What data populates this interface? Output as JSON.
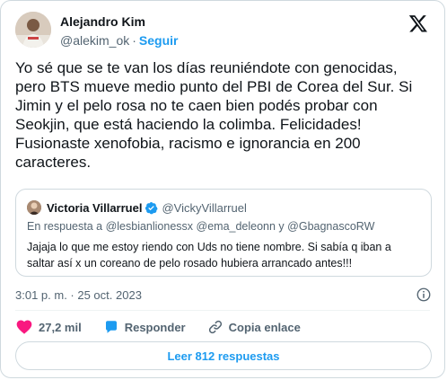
{
  "author": {
    "name": "Alejandro Kim",
    "handle": "@alekim_ok",
    "separator": "·",
    "follow_label": "Seguir"
  },
  "tweet": {
    "text": "Yo sé que se te van los días reuniéndote con genocidas,\npero BTS mueve medio punto del PBI de Corea del Sur. Si\nJimin y el pelo rosa no te caen bien podés probar con\nSeokjin, que está haciendo la colimba. Felicidades!\nFusionaste xenofobia, racismo e ignorancia en 200\ncaracteres."
  },
  "quote": {
    "name": "Victoria Villarruel",
    "handle": "@VickyVillarruel",
    "reply_prefix": "En respuesta a",
    "reply_mentions": "@lesbianlionessx @ema_deleonn y @GbagnascoRW",
    "text": "Jajaja lo que me estoy riendo con Uds no tiene nombre. Si sabía q iban a\nsaltar así x un coreano de pelo rosado hubiera arrancado antes!!!"
  },
  "meta": {
    "time": "3:01 p. m. · 25 oct. 2023"
  },
  "actions": {
    "likes": "27,2 mil",
    "reply_label": "Responder",
    "copy_label": "Copia enlace"
  },
  "read_replies_label": "Leer 812 respuestas",
  "colors": {
    "accent": "#1d9bf0",
    "like": "#f91880",
    "text": "#0f1419",
    "secondary": "#536471",
    "border": "#cfd9de"
  }
}
